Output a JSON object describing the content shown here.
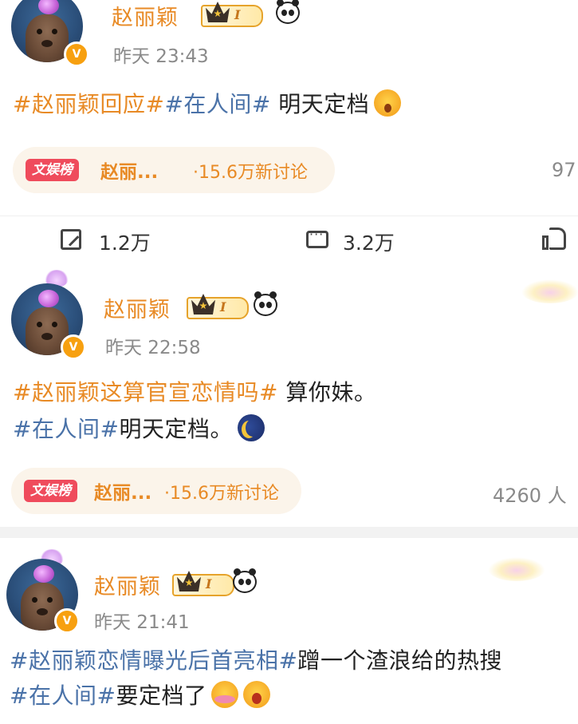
{
  "posts": [
    {
      "name": "赵丽颖",
      "level": "I",
      "time": "昨天 23:43",
      "content": {
        "topic1": "#赵丽颖回应#",
        "topic2": "#在人间#",
        "text": " 明天定档"
      },
      "emoji": [
        "surprised-face-emoji"
      ],
      "trend": {
        "tag": "文娱榜",
        "title": "赵丽...",
        "count": "·15.6万新讨论",
        "right": "97"
      },
      "actions": {
        "share": "1.2万",
        "comment": "3.2万"
      }
    },
    {
      "name": "赵丽颖",
      "level": "I",
      "time": "昨天 22:58",
      "content": {
        "topic1": "#赵丽颖这算官宣恋情吗#",
        "text1": " 算你妹。",
        "topic2": "#在人间#",
        "text2": "明天定档。"
      },
      "emoji": [
        "moon-emoji"
      ],
      "trend": {
        "tag": "文娱榜",
        "title": "赵丽...",
        "count": "·15.6万新讨论",
        "right": "4260 人"
      }
    },
    {
      "name": "赵丽颖",
      "level": "I",
      "time": "昨天 21:41",
      "content": {
        "topic1": "#赵丽颖恋情曝光后首亮相#",
        "text1": "蹭一个渣浪给的热搜",
        "topic2": "#在人间#",
        "text2": "要定档了"
      },
      "emoji": [
        "hug-emoji",
        "crying-face-emoji"
      ]
    }
  ],
  "colors": {
    "name": "#e88a25",
    "topic_orange": "#e88a25",
    "topic_blue": "#4a72a8",
    "tag_red": "#ef4b5c",
    "vbadge": "#f7a010"
  }
}
